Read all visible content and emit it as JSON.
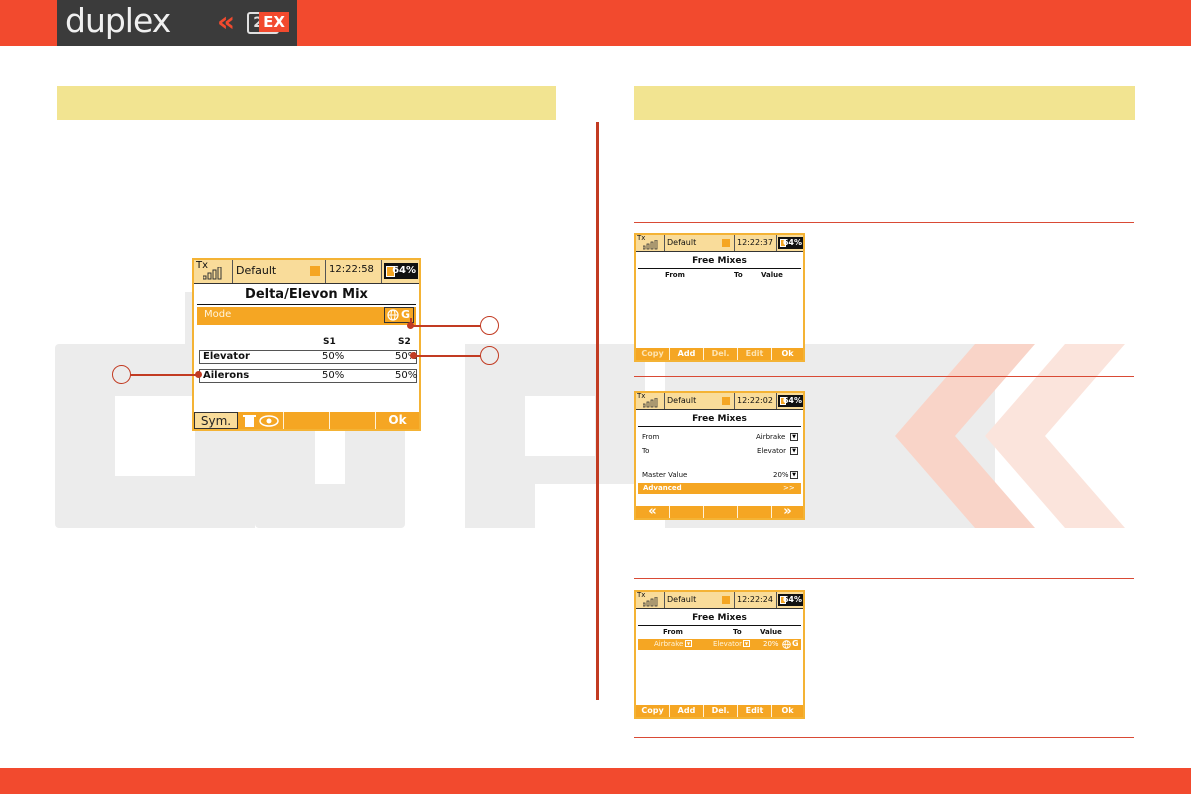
{
  "header": {
    "logo_text": "duplex",
    "logo_chevrons": "«",
    "logo_24": "24",
    "logo_ex": "EX"
  },
  "colors": {
    "brand_red": "#f24a2e",
    "band_yellow": "#f2e491",
    "screen_orange": "#f5a623"
  },
  "main_screen": {
    "tx_label": "Tx",
    "profile": "Default",
    "time": "12:22:58",
    "battery": "64%",
    "title": "Delta/Elevon Mix",
    "mode_label": "Mode",
    "mode_icon": "globe-g-icon",
    "mode_value": "G",
    "columns": [
      "S1",
      "S2"
    ],
    "rows": [
      {
        "label": "Elevator",
        "s1": "50%",
        "s2": "50%"
      },
      {
        "label": "Ailerons",
        "s1": "50%",
        "s2": "50%"
      }
    ],
    "footer": [
      "Sym.",
      "",
      "",
      "",
      "Ok"
    ]
  },
  "screen1": {
    "tx_label": "Tx",
    "profile": "Default",
    "time": "12:22:37",
    "battery": "64%",
    "title": "Free Mixes",
    "headers": [
      "From",
      "To",
      "Value"
    ],
    "footer": [
      "Copy",
      "Add",
      "Del.",
      "Edit",
      "Ok"
    ]
  },
  "screen2": {
    "tx_label": "Tx",
    "profile": "Default",
    "time": "12:22:02",
    "battery": "64%",
    "title": "Free Mixes",
    "from_label": "From",
    "from_value": "Airbrake",
    "to_label": "To",
    "to_value": "Elevator",
    "master_label": "Master Value",
    "master_value": "20%",
    "advanced_label": "Advanced",
    "advanced_value": ">>",
    "footer": [
      "«",
      "",
      "",
      "",
      "»"
    ]
  },
  "screen3": {
    "tx_label": "Tx",
    "profile": "Default",
    "time": "12:22:24",
    "battery": "64%",
    "title": "Free Mixes",
    "headers": [
      "From",
      "To",
      "Value"
    ],
    "row": {
      "from": "Airbrake",
      "to": "Elevator",
      "value": "20%",
      "icon": "globe-g-icon",
      "g": "G"
    },
    "footer": [
      "Copy",
      "Add",
      "Del.",
      "Edit",
      "Ok"
    ]
  }
}
